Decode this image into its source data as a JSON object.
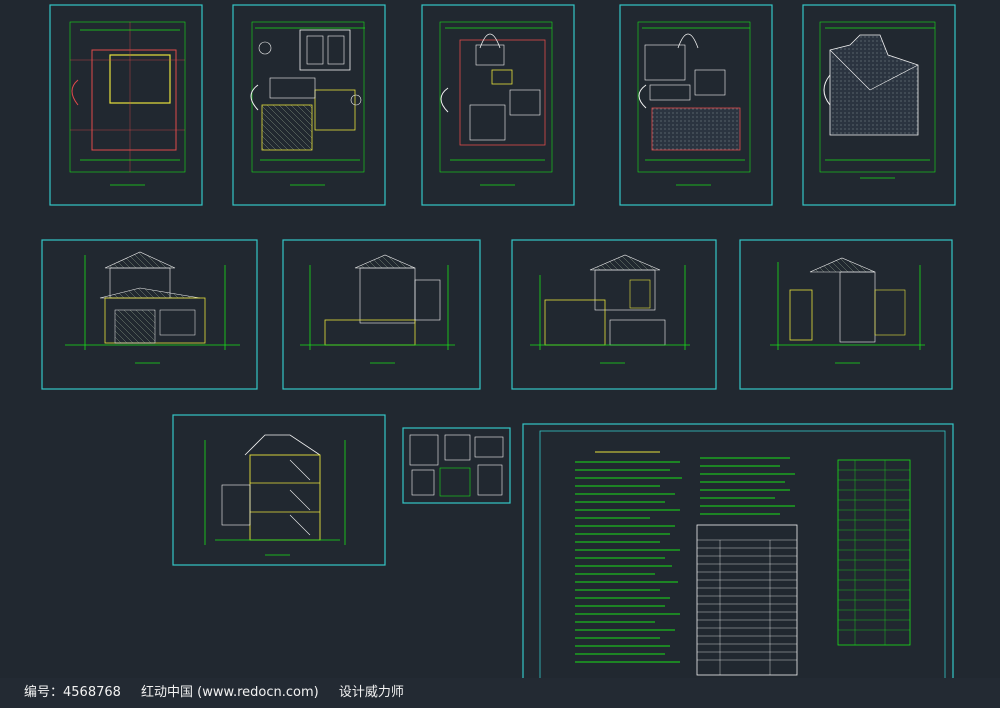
{
  "footer": {
    "id_label": "编号：4568768",
    "site_label": "红动中国 (www.redocn.com)",
    "author_label": "设计威力师"
  },
  "colors": {
    "background": "#212830",
    "sheet_border": "#35c6c6",
    "wall_green": "#19e019",
    "dimension_cyan": "#35c6c6",
    "accent_yellow": "#e8e13c",
    "accent_red": "#e04a4a",
    "text_white": "#f2f2f2"
  }
}
